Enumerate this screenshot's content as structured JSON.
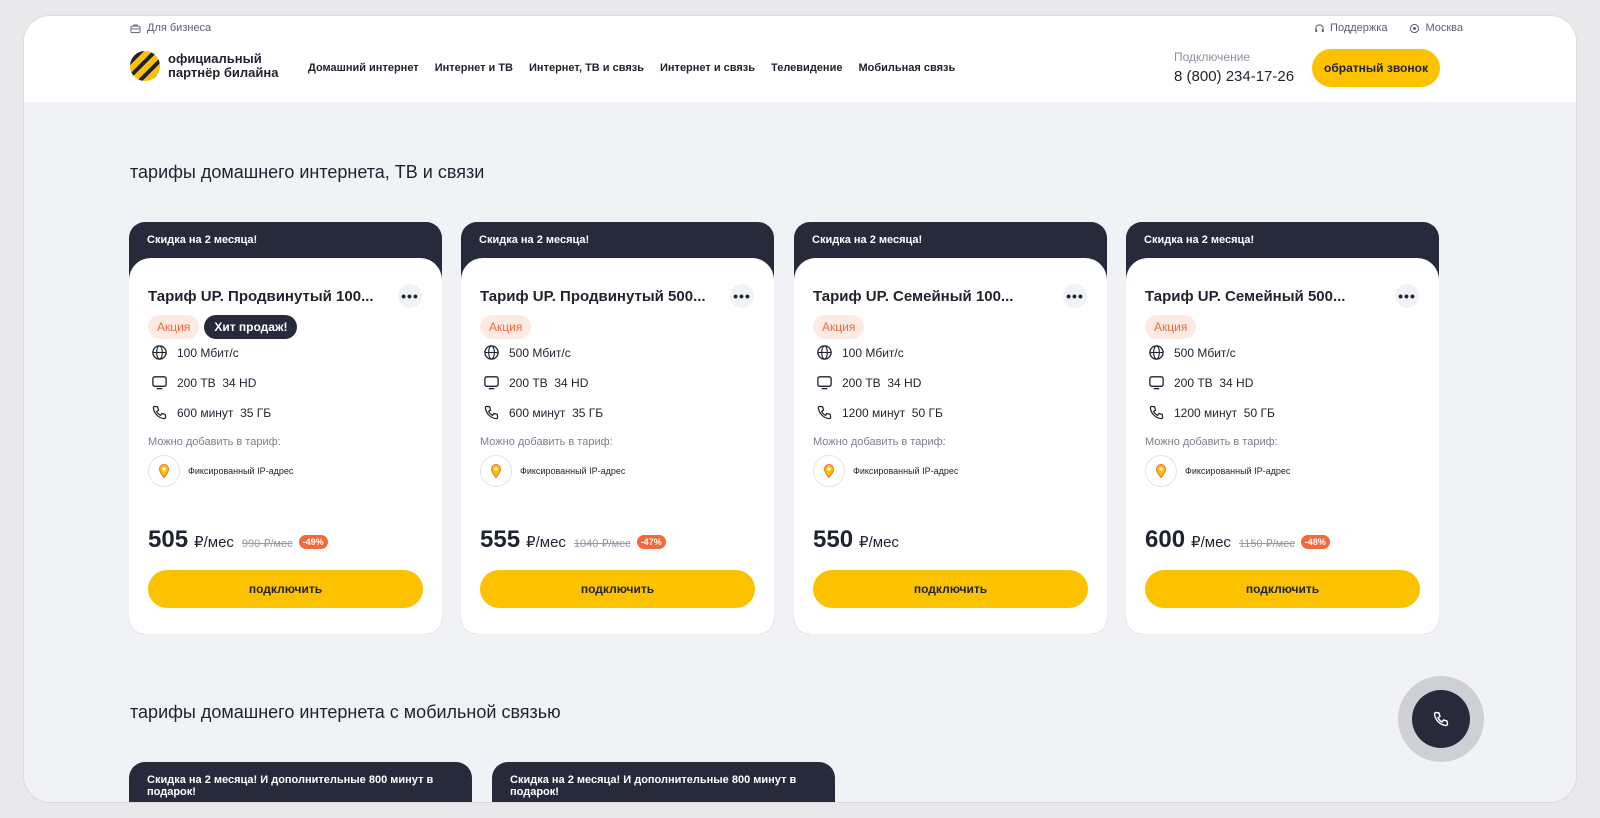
{
  "header": {
    "business_link": "Для бизнеса",
    "support_link": "Поддержка",
    "city": "Москва",
    "logo_text": "официальный партнёр билайна",
    "nav": [
      "Домашний интернет",
      "Интернет и ТВ",
      "Интернет, ТВ и связь",
      "Интернет и связь",
      "Телевидение",
      "Мобильная связь"
    ],
    "contact_label": "Подключение",
    "phone": "8 (800) 234-17-26",
    "callback_label": "обратный звонок"
  },
  "section1_title": "тарифы домашнего интернета, ТВ и связи",
  "section2_title": "тарифы домашнего интернета с мобильной связью",
  "cards": [
    {
      "ribbon": "Скидка на 2 месяца!",
      "title": "Тариф UP. Продвинутый 100...",
      "more": "•••",
      "badge_promo": "Акция",
      "badge_hit": "Хит продаж!",
      "speed": "100 Мбит/с",
      "tv": "200 ТВ  34 HD",
      "mobile": "600 минут  35 ГБ",
      "addon_label": "Можно добавить в тариф:",
      "addon": "Фиксированный IP-адрес",
      "price": "505",
      "price_unit": "₽/мес",
      "price_old": "990 ₽/мес",
      "discount": "-49%",
      "button": "подключить"
    },
    {
      "ribbon": "Скидка на 2 месяца!",
      "title": "Тариф UP. Продвинутый 500...",
      "more": "•••",
      "badge_promo": "Акция",
      "speed": "500 Мбит/с",
      "tv": "200 ТВ  34 HD",
      "mobile": "600 минут  35 ГБ",
      "addon_label": "Можно добавить в тариф:",
      "addon": "Фиксированный IP-адрес",
      "price": "555",
      "price_unit": "₽/мес",
      "price_old": "1040 ₽/мес",
      "discount": "-47%",
      "button": "подключить"
    },
    {
      "ribbon": "Скидка на 2 месяца!",
      "title": "Тариф UP. Семейный 100...",
      "more": "•••",
      "badge_promo": "Акция",
      "speed": "100 Мбит/с",
      "tv": "200 ТВ  34 HD",
      "mobile": "1200 минут  50 ГБ",
      "addon_label": "Можно добавить в тариф:",
      "addon": "Фиксированный IP-адрес",
      "price": "550",
      "price_unit": "₽/мес",
      "button": "подключить"
    },
    {
      "ribbon": "Скидка на 2 месяца!",
      "title": "Тариф UP. Семейный 500...",
      "more": "•••",
      "badge_promo": "Акция",
      "speed": "500 Мбит/с",
      "tv": "200 ТВ  34 HD",
      "mobile": "1200 минут  50 ГБ",
      "addon_label": "Можно добавить в тариф:",
      "addon": "Фиксированный IP-адрес",
      "price": "600",
      "price_unit": "₽/мес",
      "price_old": "1150 ₽/мес",
      "discount": "-48%",
      "button": "подключить"
    }
  ],
  "cards2": [
    {
      "ribbon": "Скидка на 2 месяца! И дополнительные 800 минут в подарок!"
    },
    {
      "ribbon": "Скидка на 2 месяца! И дополнительные 800 минут в подарок!"
    }
  ],
  "icons": {
    "business": "briefcase-icon",
    "support": "headset-icon",
    "city": "location-pin-icon",
    "speed": "globe-icon",
    "tv": "tv-icon",
    "mobile": "phone-icon",
    "addon": "pin-icon",
    "fab": "phone-icon"
  },
  "colors": {
    "accent": "#fcc200",
    "dark": "#262a3a",
    "promo": "#f26a3c",
    "background": "#f1f2f6"
  }
}
